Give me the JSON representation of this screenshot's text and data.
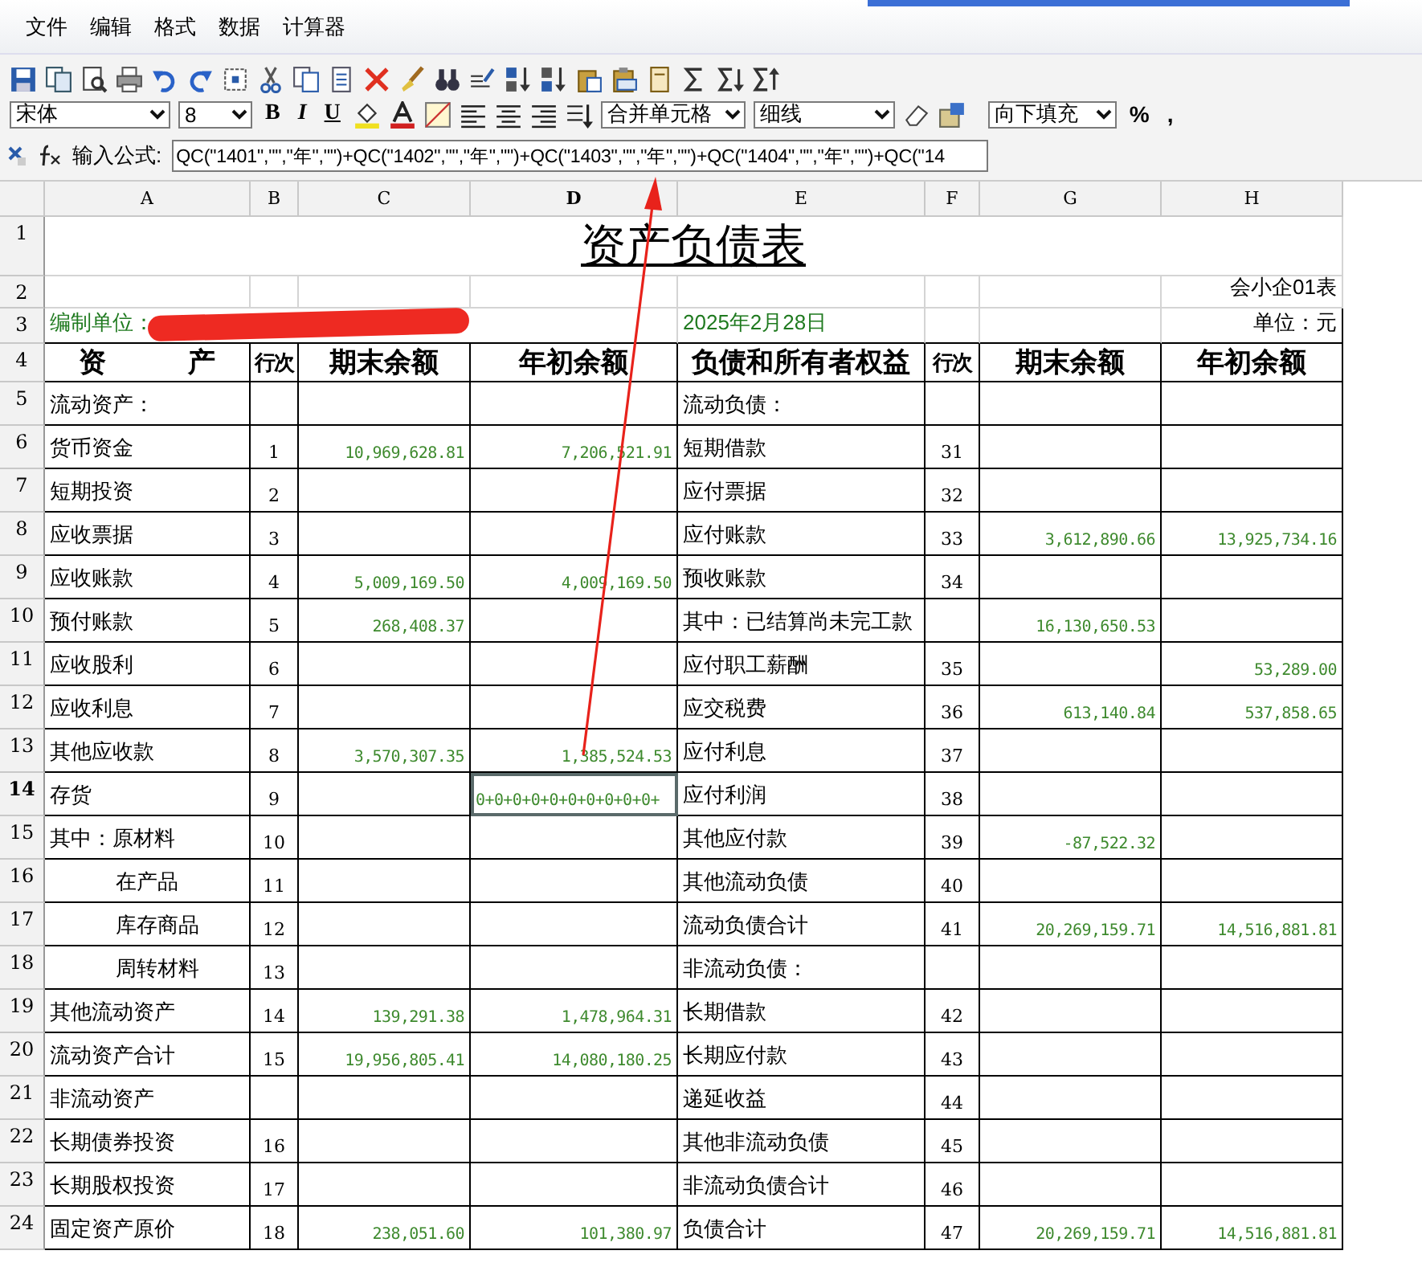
{
  "menu": [
    "文件",
    "编辑",
    "格式",
    "数据",
    "计算器"
  ],
  "format_bar": {
    "font": "宋体",
    "size": "8",
    "bold": "B",
    "italic": "I",
    "underline": "U",
    "merge": "合并单元格",
    "border": "细线",
    "fill": "向下填充",
    "percent": "%",
    "comma": ","
  },
  "formula_bar": {
    "label": "输入公式:",
    "value": "QC(\"1401\",\"\",\"年\",\"\")+QC(\"1402\",\"\",\"年\",\"\")+QC(\"1403\",\"\",\"年\",\"\")+QC(\"1404\",\"\",\"年\",\"\")+QC(\"14"
  },
  "sheet": {
    "columns": [
      {
        "label": "A",
        "selected": false
      },
      {
        "label": "B",
        "selected": false
      },
      {
        "label": "C",
        "selected": false
      },
      {
        "label": "D",
        "selected": true
      },
      {
        "label": "E",
        "selected": false
      },
      {
        "label": "F",
        "selected": false
      },
      {
        "label": "G",
        "selected": false
      },
      {
        "label": "H",
        "selected": false
      }
    ],
    "top_row_numbers": [
      "1",
      "2",
      "3",
      "4"
    ],
    "title": "资产负债表",
    "form_code": "会小企01表",
    "prepared_by": "编制单位：",
    "report_date": "2025年2月28日",
    "unit": "单位：元",
    "header": [
      "资　　　产",
      "行次",
      "期末余额",
      "年初余额",
      "负债和所有者权益",
      "行次",
      "期末余额",
      "年初余额"
    ],
    "rows": [
      {
        "number": "5",
        "selected": false,
        "indented": false,
        "cells": {
          "asset": "流动资产：",
          "liability": "流动负债："
        }
      },
      {
        "number": "6",
        "selected": false,
        "indented": false,
        "cells": {
          "asset": "货币资金",
          "line": "1",
          "end": "10,969,628.81",
          "begin": "7,206,521.91",
          "liability": "短期借款",
          "line_2": "31"
        }
      },
      {
        "number": "7",
        "selected": false,
        "indented": false,
        "cells": {
          "asset": "短期投资",
          "line": "2",
          "liability": "应付票据",
          "line_2": "32"
        }
      },
      {
        "number": "8",
        "selected": false,
        "indented": false,
        "cells": {
          "asset": "应收票据",
          "line": "3",
          "liability": "应付账款",
          "line_2": "33",
          "end_2": "3,612,890.66",
          "begin_2": "13,925,734.16"
        }
      },
      {
        "number": "9",
        "selected": false,
        "indented": false,
        "cells": {
          "asset": "应收账款",
          "line": "4",
          "end": "5,009,169.50",
          "begin": "4,009,169.50",
          "liability": "预收账款",
          "line_2": "34"
        }
      },
      {
        "number": "10",
        "selected": false,
        "indented": false,
        "cells": {
          "asset": "预付账款",
          "line": "5",
          "end": "268,408.37",
          "liability": "其中：已结算尚未完工款",
          "end_2": "16,130,650.53"
        }
      },
      {
        "number": "11",
        "selected": false,
        "indented": false,
        "cells": {
          "asset": "应收股利",
          "line": "6",
          "liability": "应付职工薪酬",
          "line_2": "35",
          "begin_2": "53,289.00"
        }
      },
      {
        "number": "12",
        "selected": false,
        "indented": false,
        "cells": {
          "asset": "应收利息",
          "line": "7",
          "liability": "应交税费",
          "line_2": "36",
          "end_2": "613,140.84",
          "begin_2": "537,858.65"
        }
      },
      {
        "number": "13",
        "selected": false,
        "indented": false,
        "cells": {
          "asset": "其他应收款",
          "line": "8",
          "end": "3,570,307.35",
          "begin": "1,385,524.53",
          "liability": "应付利息",
          "line_2": "37"
        }
      },
      {
        "number": "14",
        "selected": true,
        "indented": false,
        "cells": {
          "asset": "存货",
          "line": "9",
          "begin": "0+0+0+0+0+0+0+0+0+0+",
          "liability": "应付利润",
          "line_2": "38"
        }
      },
      {
        "number": "15",
        "selected": false,
        "indented": false,
        "cells": {
          "asset": "其中：原材料",
          "line": "10",
          "liability": "其他应付款",
          "line_2": "39",
          "end_2": "-87,522.32"
        }
      },
      {
        "number": "16",
        "selected": false,
        "indented": true,
        "cells": {
          "asset": "在产品",
          "line": "11",
          "liability": "其他流动负债",
          "line_2": "40"
        }
      },
      {
        "number": "17",
        "selected": false,
        "indented": true,
        "cells": {
          "asset": "库存商品",
          "line": "12",
          "liability": "流动负债合计",
          "line_2": "41",
          "end_2": "20,269,159.71",
          "begin_2": "14,516,881.81"
        }
      },
      {
        "number": "18",
        "selected": false,
        "indented": true,
        "cells": {
          "asset": "周转材料",
          "line": "13",
          "liability": "非流动负债："
        }
      },
      {
        "number": "19",
        "selected": false,
        "indented": false,
        "cells": {
          "asset": "其他流动资产",
          "line": "14",
          "end": "139,291.38",
          "begin": "1,478,964.31",
          "liability": "长期借款",
          "line_2": "42"
        }
      },
      {
        "number": "20",
        "selected": false,
        "indented": false,
        "cells": {
          "asset": "流动资产合计",
          "line": "15",
          "end": "19,956,805.41",
          "begin": "14,080,180.25",
          "liability": "长期应付款",
          "line_2": "43"
        }
      },
      {
        "number": "21",
        "selected": false,
        "indented": false,
        "cells": {
          "asset": "非流动资产",
          "liability": "递延收益",
          "line_2": "44"
        }
      },
      {
        "number": "22",
        "selected": false,
        "indented": false,
        "cells": {
          "asset": "长期债券投资",
          "line": "16",
          "liability": "其他非流动负债",
          "line_2": "45"
        }
      },
      {
        "number": "23",
        "selected": false,
        "indented": false,
        "cells": {
          "asset": "长期股权投资",
          "line": "17",
          "liability": "非流动负债合计",
          "line_2": "46"
        }
      },
      {
        "number": "24",
        "selected": false,
        "indented": false,
        "cells": {
          "asset": "固定资产原价",
          "line": "18",
          "end": "238,051.60",
          "begin": "101,380.97",
          "liability": "负债合计",
          "line_2": "47",
          "end_2": "20,269,159.71",
          "begin_2": "14,516,881.81"
        }
      }
    ]
  }
}
